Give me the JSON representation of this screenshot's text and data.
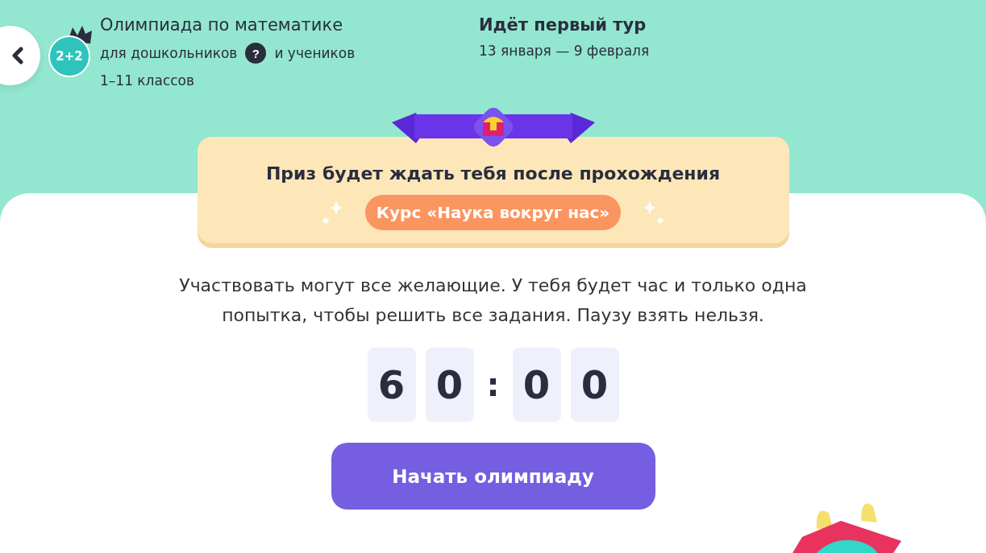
{
  "header": {
    "title": "Олимпиада по математике",
    "audience_start": "для дошкольников",
    "help": "?",
    "audience_end": "и учеников",
    "grades": "1–11 классов",
    "logo_text": "2+2",
    "round_title": "Идёт первый тур",
    "round_dates": "13 января — 9 февраля"
  },
  "prize": {
    "title": "Приз будет ждать тебя после прохождения",
    "course": "Курс «Наука вокруг нас»"
  },
  "description": "Участвовать могут все желающие. У тебя будет час и только одна попытка, чтобы решить все задания. Паузу взять нельзя.",
  "timer": {
    "digits": [
      "6",
      "0",
      "0",
      "0"
    ],
    "separator": ":"
  },
  "start_button": "Начать олимпиаду"
}
